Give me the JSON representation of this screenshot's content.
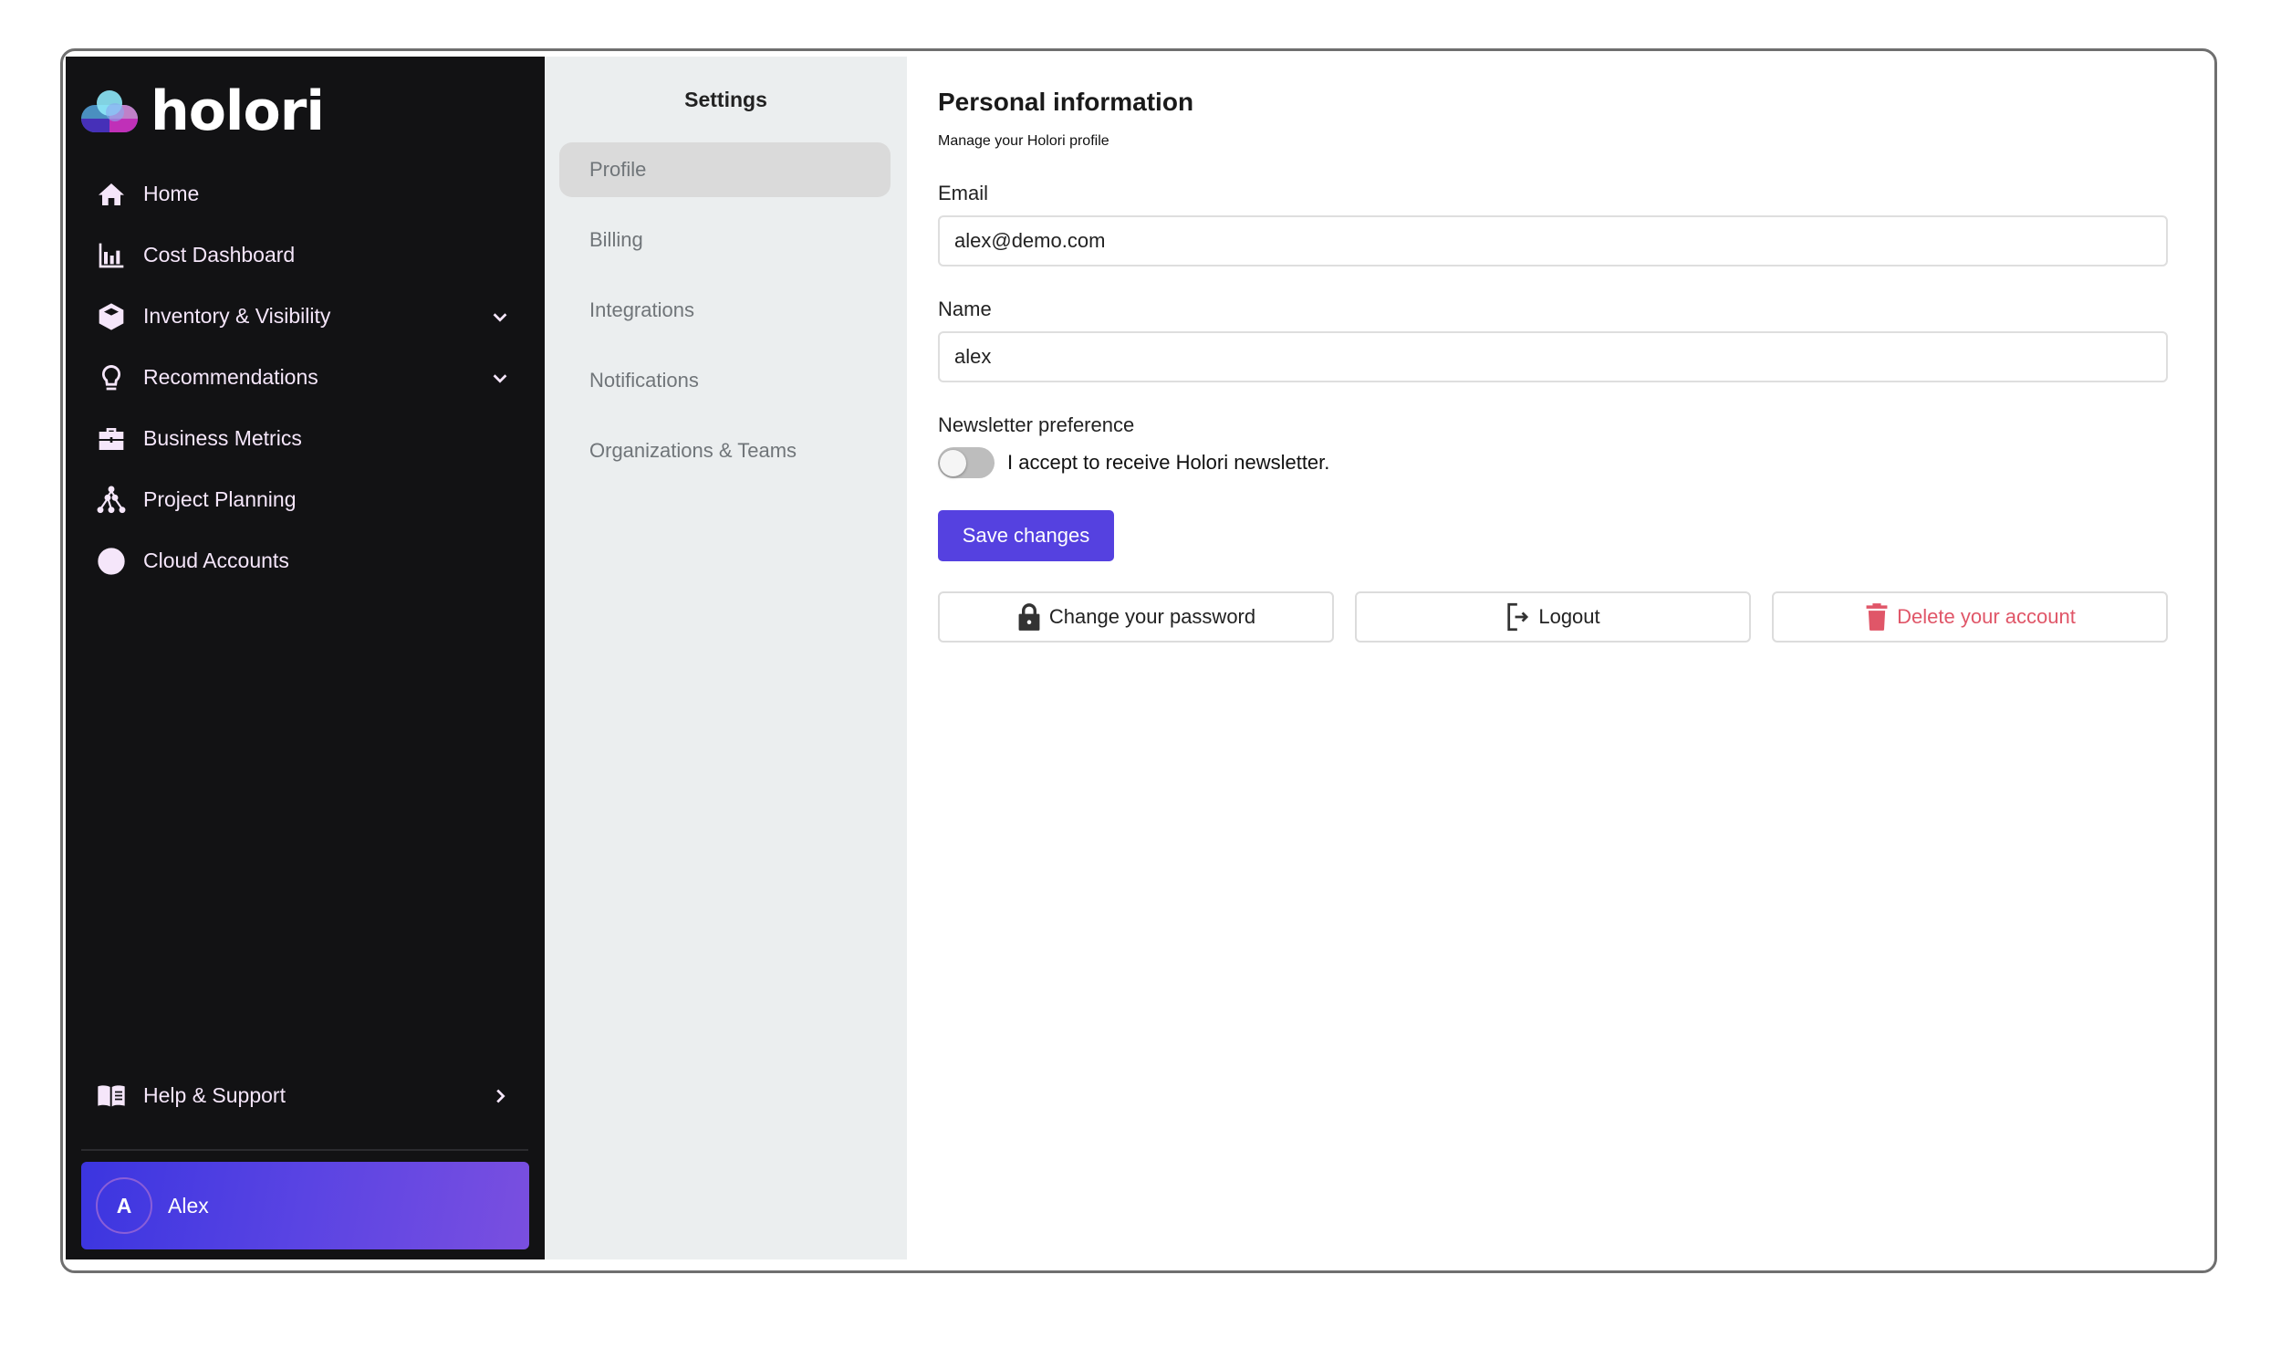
{
  "app": {
    "brand": "holori"
  },
  "sidebar": {
    "items": [
      {
        "label": "Home",
        "icon": "home-icon",
        "has_chevron": false
      },
      {
        "label": "Cost Dashboard",
        "icon": "bar-chart-icon",
        "has_chevron": false
      },
      {
        "label": "Inventory & Visibility",
        "icon": "cube-icon",
        "has_chevron": true
      },
      {
        "label": "Recommendations",
        "icon": "lightbulb-icon",
        "has_chevron": true
      },
      {
        "label": "Business Metrics",
        "icon": "briefcase-icon",
        "has_chevron": false
      },
      {
        "label": "Project Planning",
        "icon": "network-tree-icon",
        "has_chevron": false
      },
      {
        "label": "Cloud Accounts",
        "icon": "cloud-circle-icon",
        "has_chevron": false
      }
    ],
    "help": {
      "label": "Help & Support",
      "icon": "book-icon"
    },
    "user": {
      "initial": "A",
      "name": "Alex"
    }
  },
  "settings": {
    "title": "Settings",
    "items": [
      {
        "label": "Profile",
        "active": true
      },
      {
        "label": "Billing",
        "active": false
      },
      {
        "label": "Integrations",
        "active": false
      },
      {
        "label": "Notifications",
        "active": false
      },
      {
        "label": "Organizations & Teams",
        "active": false
      }
    ]
  },
  "profile": {
    "title": "Personal information",
    "subtitle": "Manage your Holori profile",
    "email": {
      "label": "Email",
      "value": "alex@demo.com"
    },
    "name": {
      "label": "Name",
      "value": "alex"
    },
    "newsletter": {
      "label": "Newsletter preference",
      "toggle_label": "I accept to receive Holori newsletter.",
      "enabled": false
    },
    "save_label": "Save changes",
    "actions": {
      "change_password": "Change your password",
      "logout": "Logout",
      "delete_account": "Delete your account"
    }
  },
  "colors": {
    "sidebar_bg": "#121214",
    "sidebar_text": "#F5E6FA",
    "settings_bg": "#EBEEEF",
    "primary": "#5541E0",
    "danger": "#E05668"
  }
}
